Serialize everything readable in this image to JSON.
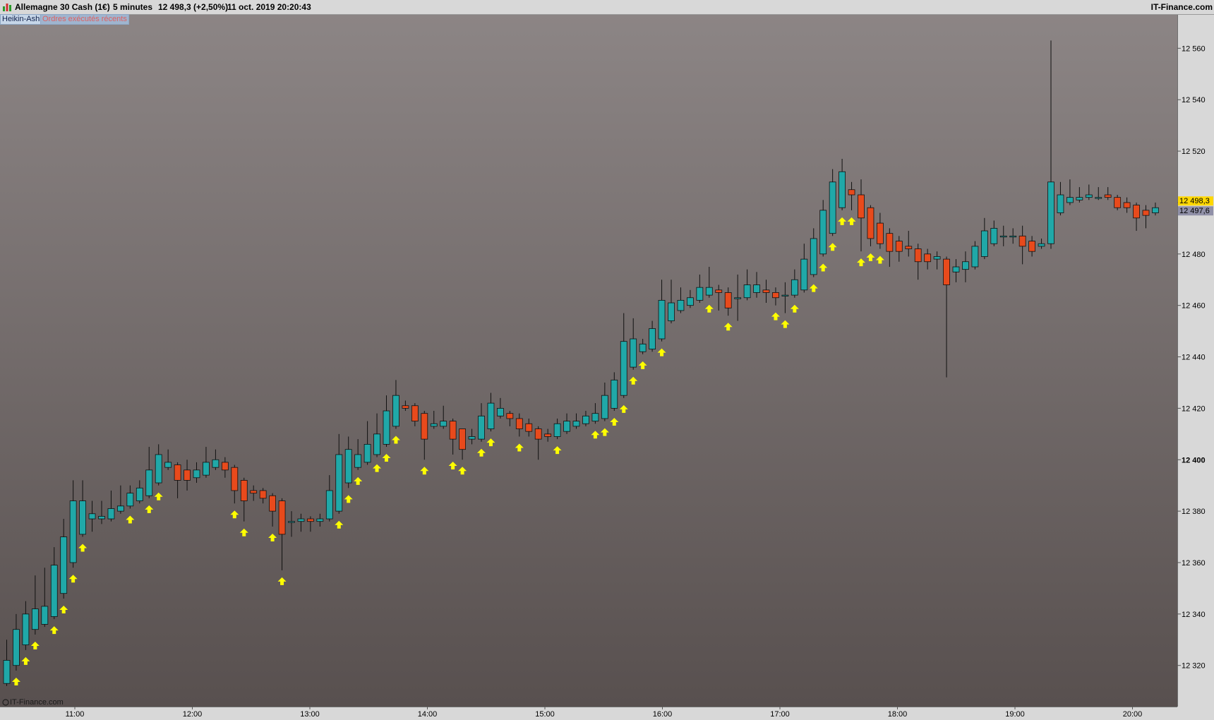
{
  "titlebar": {
    "instrument": "Allemagne 30 Cash (1€)",
    "timeframe": "5 minutes",
    "quote": "12 498,3 (+2,50%)",
    "datetime": "11 oct. 2019 20:20:43",
    "brand": "IT-Finance.com"
  },
  "tags": {
    "indicator": "Heikin-Ashi",
    "orders": "Ordres exécutés récents"
  },
  "watermark": "IT-Finance.com",
  "colors": {
    "up": "#20a8a8",
    "down": "#e84a1c",
    "arrow": "#ffff00",
    "current_price_bg": "#ffd800",
    "prev_price_bg": "#9090a8"
  },
  "chart_data": {
    "type": "candlestick",
    "style": "Heikin-Ashi",
    "y_ticks": [
      "12 320",
      "12 340",
      "12 360",
      "12 380",
      "12 400",
      "12 420",
      "12 440",
      "12 460",
      "12 480",
      "12 500",
      "12 520",
      "12 540",
      "12 560"
    ],
    "y_tick_values": [
      12320,
      12340,
      12360,
      12380,
      12400,
      12420,
      12440,
      12460,
      12480,
      12500,
      12520,
      12540,
      12560
    ],
    "highlighted_tick": "12 400",
    "x_ticks": [
      "11:00",
      "12:00",
      "13:00",
      "14:00",
      "15:00",
      "16:00",
      "17:00",
      "18:00",
      "19:00",
      "20:00"
    ],
    "ylim": [
      12304,
      12573
    ],
    "current_price_label": "12 498,3",
    "prev_price_label": "12 497,6",
    "candles": [
      {
        "o": 12313,
        "c": 12322,
        "h": 12330,
        "l": 12312
      },
      {
        "o": 12320,
        "c": 12334,
        "h": 12340,
        "l": 12318
      },
      {
        "o": 12328,
        "c": 12340,
        "h": 12345,
        "l": 12326
      },
      {
        "o": 12334,
        "c": 12342,
        "h": 12355,
        "l": 12332
      },
      {
        "o": 12336,
        "c": 12343,
        "h": 12358,
        "l": 12335
      },
      {
        "o": 12339,
        "c": 12359,
        "h": 12366,
        "l": 12338
      },
      {
        "o": 12348,
        "c": 12370,
        "h": 12377,
        "l": 12346
      },
      {
        "o": 12360,
        "c": 12384,
        "h": 12392,
        "l": 12358
      },
      {
        "o": 12371,
        "c": 12384,
        "h": 12392,
        "l": 12370
      },
      {
        "o": 12377,
        "c": 12379,
        "h": 12384,
        "l": 12372
      },
      {
        "o": 12377,
        "c": 12378,
        "h": 12384,
        "l": 12375
      },
      {
        "o": 12377,
        "c": 12381,
        "h": 12388,
        "l": 12376
      },
      {
        "o": 12380,
        "c": 12382,
        "h": 12390,
        "l": 12379
      },
      {
        "o": 12382,
        "c": 12387,
        "h": 12390,
        "l": 12381
      },
      {
        "o": 12384,
        "c": 12389,
        "h": 12392,
        "l": 12383
      },
      {
        "o": 12386,
        "c": 12396,
        "h": 12405,
        "l": 12385
      },
      {
        "o": 12391,
        "c": 12402,
        "h": 12406,
        "l": 12390
      },
      {
        "o": 12397,
        "c": 12399,
        "h": 12404,
        "l": 12396
      },
      {
        "o": 12398,
        "c": 12392,
        "h": 12399,
        "l": 12385
      },
      {
        "o": 12396,
        "c": 12392,
        "h": 12400,
        "l": 12388
      },
      {
        "o": 12393,
        "c": 12396,
        "h": 12399,
        "l": 12391
      },
      {
        "o": 12394,
        "c": 12399,
        "h": 12405,
        "l": 12393
      },
      {
        "o": 12397,
        "c": 12400,
        "h": 12404,
        "l": 12396
      },
      {
        "o": 12399,
        "c": 12396,
        "h": 12401,
        "l": 12393
      },
      {
        "o": 12397,
        "c": 12388,
        "h": 12398,
        "l": 12383
      },
      {
        "o": 12392,
        "c": 12384,
        "h": 12393,
        "l": 12376
      },
      {
        "o": 12388,
        "c": 12387,
        "h": 12390,
        "l": 12384
      },
      {
        "o": 12388,
        "c": 12385,
        "h": 12389,
        "l": 12383
      },
      {
        "o": 12386,
        "c": 12380,
        "h": 12387,
        "l": 12374
      },
      {
        "o": 12384,
        "c": 12371,
        "h": 12385,
        "l": 12357
      },
      {
        "o": 12376,
        "c": 12376,
        "h": 12380,
        "l": 12370
      },
      {
        "o": 12376,
        "c": 12377,
        "h": 12379,
        "l": 12372
      },
      {
        "o": 12377,
        "c": 12376,
        "h": 12378,
        "l": 12372
      },
      {
        "o": 12376,
        "c": 12377,
        "h": 12379,
        "l": 12374
      },
      {
        "o": 12377,
        "c": 12388,
        "h": 12394,
        "l": 12376
      },
      {
        "o": 12380,
        "c": 12402,
        "h": 12410,
        "l": 12379
      },
      {
        "o": 12391,
        "c": 12404,
        "h": 12409,
        "l": 12389
      },
      {
        "o": 12397,
        "c": 12402,
        "h": 12408,
        "l": 12396
      },
      {
        "o": 12399,
        "c": 12406,
        "h": 12415,
        "l": 12398
      },
      {
        "o": 12402,
        "c": 12410,
        "h": 12418,
        "l": 12401
      },
      {
        "o": 12406,
        "c": 12419,
        "h": 12425,
        "l": 12405
      },
      {
        "o": 12413,
        "c": 12425,
        "h": 12431,
        "l": 12412
      },
      {
        "o": 12421,
        "c": 12420,
        "h": 12423,
        "l": 12419
      },
      {
        "o": 12421,
        "c": 12415,
        "h": 12422,
        "l": 12413
      },
      {
        "o": 12418,
        "c": 12408,
        "h": 12419,
        "l": 12400
      },
      {
        "o": 12413,
        "c": 12414,
        "h": 12419,
        "l": 12412
      },
      {
        "o": 12413,
        "c": 12415,
        "h": 12421,
        "l": 12412
      },
      {
        "o": 12415,
        "c": 12408,
        "h": 12416,
        "l": 12402
      },
      {
        "o": 12412,
        "c": 12404,
        "h": 12412,
        "l": 12400
      },
      {
        "o": 12408,
        "c": 12409,
        "h": 12412,
        "l": 12406
      },
      {
        "o": 12408,
        "c": 12417,
        "h": 12422,
        "l": 12407
      },
      {
        "o": 12412,
        "c": 12422,
        "h": 12426,
        "l": 12411
      },
      {
        "o": 12417,
        "c": 12420,
        "h": 12424,
        "l": 12416
      },
      {
        "o": 12418,
        "c": 12416,
        "h": 12419,
        "l": 12413
      },
      {
        "o": 12416,
        "c": 12412,
        "h": 12418,
        "l": 12409
      },
      {
        "o": 12414,
        "c": 12411,
        "h": 12416,
        "l": 12409
      },
      {
        "o": 12412,
        "c": 12408,
        "h": 12413,
        "l": 12400
      },
      {
        "o": 12410,
        "c": 12409,
        "h": 12412,
        "l": 12407
      },
      {
        "o": 12409,
        "c": 12414,
        "h": 12416,
        "l": 12408
      },
      {
        "o": 12411,
        "c": 12415,
        "h": 12418,
        "l": 12410
      },
      {
        "o": 12413,
        "c": 12415,
        "h": 12418,
        "l": 12412
      },
      {
        "o": 12414,
        "c": 12417,
        "h": 12419,
        "l": 12413
      },
      {
        "o": 12415,
        "c": 12418,
        "h": 12422,
        "l": 12414
      },
      {
        "o": 12416,
        "c": 12425,
        "h": 12430,
        "l": 12415
      },
      {
        "o": 12420,
        "c": 12431,
        "h": 12434,
        "l": 12419
      },
      {
        "o": 12425,
        "c": 12446,
        "h": 12457,
        "l": 12424
      },
      {
        "o": 12436,
        "c": 12447,
        "h": 12455,
        "l": 12435
      },
      {
        "o": 12442,
        "c": 12445,
        "h": 12447,
        "l": 12441
      },
      {
        "o": 12443,
        "c": 12451,
        "h": 12454,
        "l": 12442
      },
      {
        "o": 12447,
        "c": 12462,
        "h": 12470,
        "l": 12446
      },
      {
        "o": 12454,
        "c": 12461,
        "h": 12470,
        "l": 12453
      },
      {
        "o": 12458,
        "c": 12462,
        "h": 12467,
        "l": 12457
      },
      {
        "o": 12460,
        "c": 12463,
        "h": 12466,
        "l": 12459
      },
      {
        "o": 12462,
        "c": 12467,
        "h": 12472,
        "l": 12461
      },
      {
        "o": 12464,
        "c": 12467,
        "h": 12475,
        "l": 12463
      },
      {
        "o": 12466,
        "c": 12465,
        "h": 12468,
        "l": 12458
      },
      {
        "o": 12465,
        "c": 12459,
        "h": 12467,
        "l": 12456
      },
      {
        "o": 12463,
        "c": 12463,
        "h": 12472,
        "l": 12454
      },
      {
        "o": 12463,
        "c": 12468,
        "h": 12474,
        "l": 12462
      },
      {
        "o": 12465,
        "c": 12468,
        "h": 12473,
        "l": 12463
      },
      {
        "o": 12466,
        "c": 12465,
        "h": 12470,
        "l": 12461
      },
      {
        "o": 12465,
        "c": 12463,
        "h": 12467,
        "l": 12460
      },
      {
        "o": 12464,
        "c": 12464,
        "h": 12469,
        "l": 12457
      },
      {
        "o": 12464,
        "c": 12470,
        "h": 12474,
        "l": 12463
      },
      {
        "o": 12466,
        "c": 12478,
        "h": 12484,
        "l": 12465
      },
      {
        "o": 12472,
        "c": 12486,
        "h": 12490,
        "l": 12471
      },
      {
        "o": 12480,
        "c": 12497,
        "h": 12501,
        "l": 12479
      },
      {
        "o": 12488,
        "c": 12508,
        "h": 12513,
        "l": 12487
      },
      {
        "o": 12498,
        "c": 12512,
        "h": 12517,
        "l": 12497
      },
      {
        "o": 12505,
        "c": 12503,
        "h": 12508,
        "l": 12497
      },
      {
        "o": 12503,
        "c": 12494,
        "h": 12509,
        "l": 12481
      },
      {
        "o": 12498,
        "c": 12486,
        "h": 12499,
        "l": 12483
      },
      {
        "o": 12492,
        "c": 12484,
        "h": 12496,
        "l": 12482
      },
      {
        "o": 12488,
        "c": 12481,
        "h": 12490,
        "l": 12475
      },
      {
        "o": 12485,
        "c": 12481,
        "h": 12487,
        "l": 12477
      },
      {
        "o": 12483,
        "c": 12482,
        "h": 12489,
        "l": 12479
      },
      {
        "o": 12482,
        "c": 12477,
        "h": 12484,
        "l": 12470
      },
      {
        "o": 12480,
        "c": 12477,
        "h": 12482,
        "l": 12474
      },
      {
        "o": 12478,
        "c": 12479,
        "h": 12481,
        "l": 12474
      },
      {
        "o": 12478,
        "c": 12468,
        "h": 12479,
        "l": 12432
      },
      {
        "o": 12473,
        "c": 12475,
        "h": 12478,
        "l": 12469
      },
      {
        "o": 12474,
        "c": 12477,
        "h": 12481,
        "l": 12469
      },
      {
        "o": 12475,
        "c": 12483,
        "h": 12485,
        "l": 12474
      },
      {
        "o": 12479,
        "c": 12489,
        "h": 12494,
        "l": 12478
      },
      {
        "o": 12484,
        "c": 12490,
        "h": 12493,
        "l": 12483
      },
      {
        "o": 12487,
        "c": 12487,
        "h": 12491,
        "l": 12483
      },
      {
        "o": 12487,
        "c": 12487,
        "h": 12490,
        "l": 12484
      },
      {
        "o": 12487,
        "c": 12483,
        "h": 12491,
        "l": 12476
      },
      {
        "o": 12485,
        "c": 12481,
        "h": 12487,
        "l": 12479
      },
      {
        "o": 12483,
        "c": 12484,
        "h": 12486,
        "l": 12482
      },
      {
        "o": 12484,
        "c": 12508,
        "h": 12563,
        "l": 12482
      },
      {
        "o": 12496,
        "c": 12503,
        "h": 12508,
        "l": 12495
      },
      {
        "o": 12500,
        "c": 12502,
        "h": 12509,
        "l": 12499
      },
      {
        "o": 12501,
        "c": 12502,
        "h": 12506,
        "l": 12500
      },
      {
        "o": 12502,
        "c": 12503,
        "h": 12507,
        "l": 12501
      },
      {
        "o": 12502,
        "c": 12502,
        "h": 12506,
        "l": 12501
      },
      {
        "o": 12503,
        "c": 12502,
        "h": 12506,
        "l": 12501
      },
      {
        "o": 12502,
        "c": 12498,
        "h": 12503,
        "l": 12497
      },
      {
        "o": 12500,
        "c": 12498,
        "h": 12502,
        "l": 12496
      },
      {
        "o": 12499,
        "c": 12494,
        "h": 12500,
        "l": 12489
      },
      {
        "o": 12497,
        "c": 12495,
        "h": 12499,
        "l": 12490
      },
      {
        "o": 12496,
        "c": 12498,
        "h": 12500,
        "l": 12495
      }
    ],
    "arrow_candles": [
      1,
      2,
      3,
      5,
      6,
      7,
      8,
      13,
      15,
      16,
      24,
      25,
      28,
      29,
      35,
      36,
      37,
      39,
      40,
      41,
      44,
      47,
      48,
      50,
      51,
      54,
      58,
      62,
      63,
      64,
      65,
      66,
      67,
      69,
      74,
      76,
      81,
      82,
      83,
      85,
      86,
      87,
      88,
      89,
      90,
      91,
      92
    ]
  }
}
